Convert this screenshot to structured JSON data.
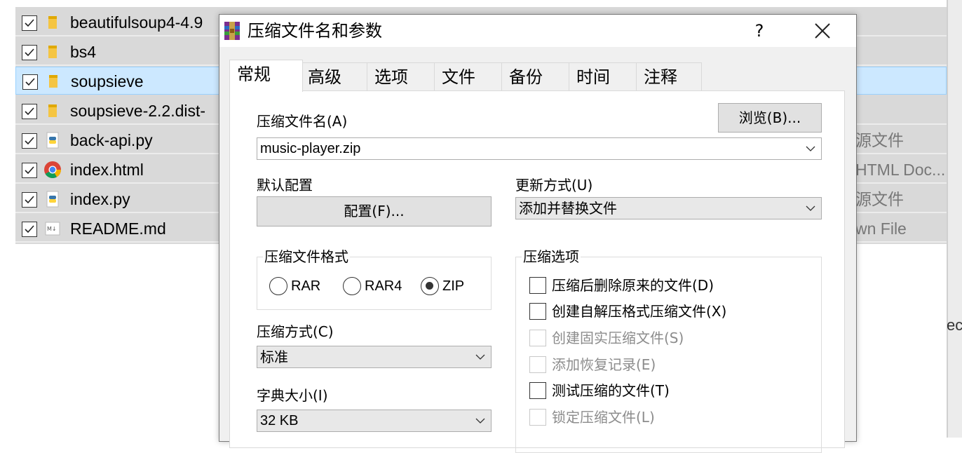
{
  "explorer": {
    "files": [
      {
        "name": "beautifulsoup4-4.9",
        "icon": "folder-icon",
        "type": ""
      },
      {
        "name": "bs4",
        "icon": "folder-icon",
        "type": ""
      },
      {
        "name": "soupsieve",
        "icon": "folder-icon",
        "type": ""
      },
      {
        "name": "soupsieve-2.2.dist-",
        "icon": "folder-icon",
        "type": ""
      },
      {
        "name": "back-api.py",
        "icon": "python-file-icon",
        "type": "源文件"
      },
      {
        "name": "index.html",
        "icon": "chrome-icon",
        "type": "HTML Doc..."
      },
      {
        "name": "index.py",
        "icon": "python-file-icon",
        "type": "源文件"
      },
      {
        "name": "README.md",
        "icon": "markdown-file-icon",
        "type": "wn File"
      }
    ],
    "right_edge_text": "ec"
  },
  "dialog": {
    "title": "压缩文件名和参数",
    "help_label": "?",
    "tabs": [
      "常规",
      "高级",
      "选项",
      "文件",
      "备份",
      "时间",
      "注释"
    ],
    "archive_name_label": "压缩文件名(A)",
    "browse_label": "浏览(B)...",
    "archive_name_value": "music-player.zip",
    "default_profile_label": "默认配置",
    "profile_button_label": "配置(F)...",
    "update_mode_label": "更新方式(U)",
    "update_mode_value": "添加并替换文件",
    "format_group_label": "压缩文件格式",
    "formats": [
      {
        "label": "RAR",
        "selected": false
      },
      {
        "label": "RAR4",
        "selected": false
      },
      {
        "label": "ZIP",
        "selected": true
      }
    ],
    "method_label": "压缩方式(C)",
    "method_value": "标准",
    "dict_label": "字典大小(I)",
    "dict_value": "32 KB",
    "options_group_label": "压缩选项",
    "options": [
      {
        "label": "压缩后删除原来的文件(D)",
        "checked": false,
        "enabled": true
      },
      {
        "label": "创建自解压格式压缩文件(X)",
        "checked": false,
        "enabled": true
      },
      {
        "label": "创建固实压缩文件(S)",
        "checked": false,
        "enabled": false
      },
      {
        "label": "添加恢复记录(E)",
        "checked": false,
        "enabled": false
      },
      {
        "label": "测试压缩的文件(T)",
        "checked": false,
        "enabled": true
      },
      {
        "label": "锁定压缩文件(L)",
        "checked": false,
        "enabled": false
      }
    ]
  }
}
